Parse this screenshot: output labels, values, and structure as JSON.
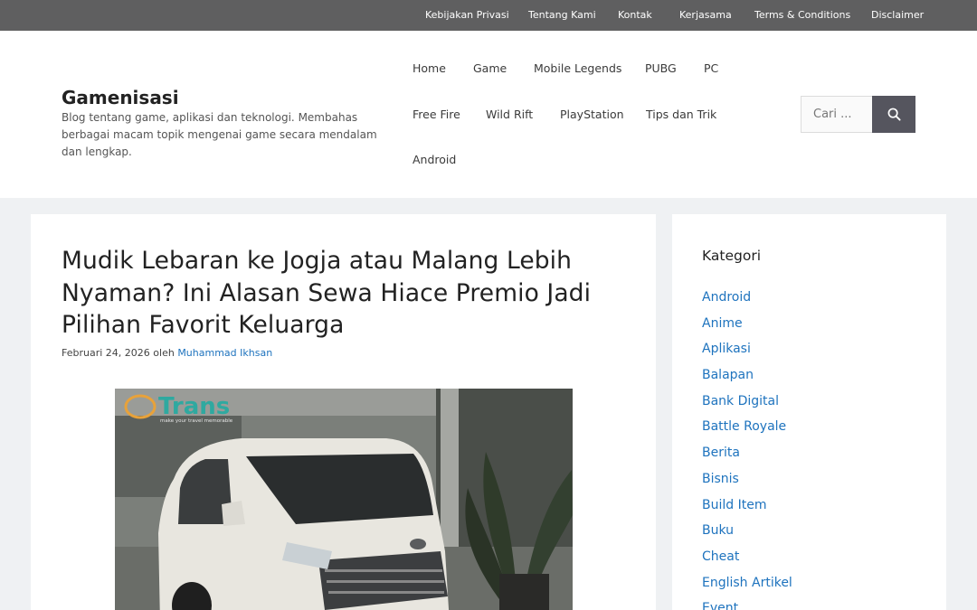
{
  "topbar": {
    "links": [
      "Kebijakan Privasi",
      "Tentang Kami",
      "Kontak",
      "Kerjasama",
      "Terms & Conditions",
      "Disclaimer"
    ]
  },
  "header": {
    "site_title": "Gamenisasi",
    "tagline": "Blog tentang game, aplikasi dan teknologi. Membahas berbagai macam topik mengenai game secara mendalam dan lengkap."
  },
  "nav": {
    "items": [
      "Home",
      "Game",
      "Mobile Legends",
      "PUBG",
      "PC",
      "Free Fire",
      "Wild Rift",
      "PlayStation",
      "Tips dan Trik",
      "Android"
    ]
  },
  "search": {
    "placeholder": "Cari ...",
    "icon": "search-icon"
  },
  "article": {
    "title": "Mudik Lebaran ke Jogja atau Malang Lebih Nyaman? Ini Alasan Sewa Hiace Premio Jadi Pilihan Favorit Keluarga",
    "date": "Februari 24, 2026",
    "by": "oleh",
    "author": "Muhammad Ikhsan",
    "image_logo_text": "Trans",
    "image_logo_subtext": "make your travel memorable"
  },
  "sidebar": {
    "widget_title": "Kategori",
    "categories": [
      "Android",
      "Anime",
      "Aplikasi",
      "Balapan",
      "Bank Digital",
      "Battle Royale",
      "Berita",
      "Bisnis",
      "Build Item",
      "Buku",
      "Cheat",
      "English Artikel",
      "Event"
    ]
  },
  "colors": {
    "topbar_bg": "#5f5f60",
    "link_blue": "#1e73be",
    "search_button": "#55555e",
    "page_bg": "#eff1f3"
  }
}
